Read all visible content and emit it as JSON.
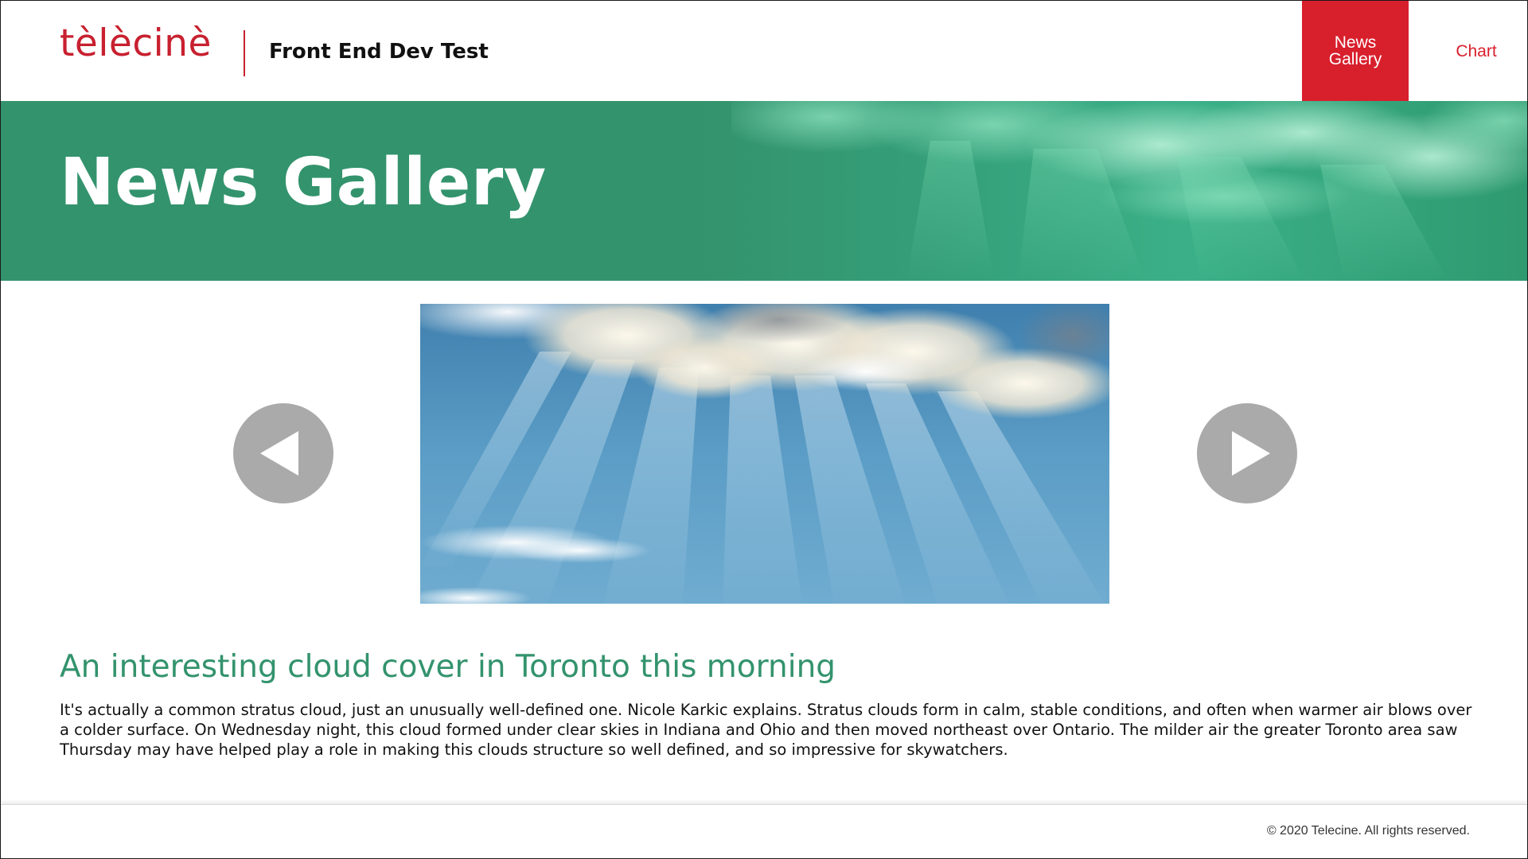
{
  "header": {
    "logo_text": "tèlècinè",
    "site_title": "Front End Dev Test",
    "nav": [
      {
        "label": "News Gallery",
        "active": true
      },
      {
        "label": "Chart",
        "active": false
      }
    ]
  },
  "hero": {
    "title": "News Gallery"
  },
  "gallery": {
    "prev_icon": "triangle-left-icon",
    "next_icon": "triangle-right-icon",
    "image_subject": "clouds with sun rays in blue sky"
  },
  "article": {
    "title": "An interesting cloud cover in Toronto this morning",
    "body": "It's actually a common stratus cloud, just an unusually well-defined one. Nicole Karkic explains. Stratus clouds form in calm, stable conditions, and often when warmer air blows over a colder surface. On Wednesday night, this cloud formed under clear skies in Indiana and Ohio and then moved northeast over Ontario. The milder air the greater Toronto area saw Thursday may have helped play a role in making this clouds structure so well defined, and so impressive for skywatchers."
  },
  "footer": {
    "copyright": "© 2020 Telecine. All rights reserved."
  },
  "colors": {
    "brand_red": "#d81f2c",
    "brand_green": "#33936d",
    "arrow_gray": "#aaaaaa"
  }
}
